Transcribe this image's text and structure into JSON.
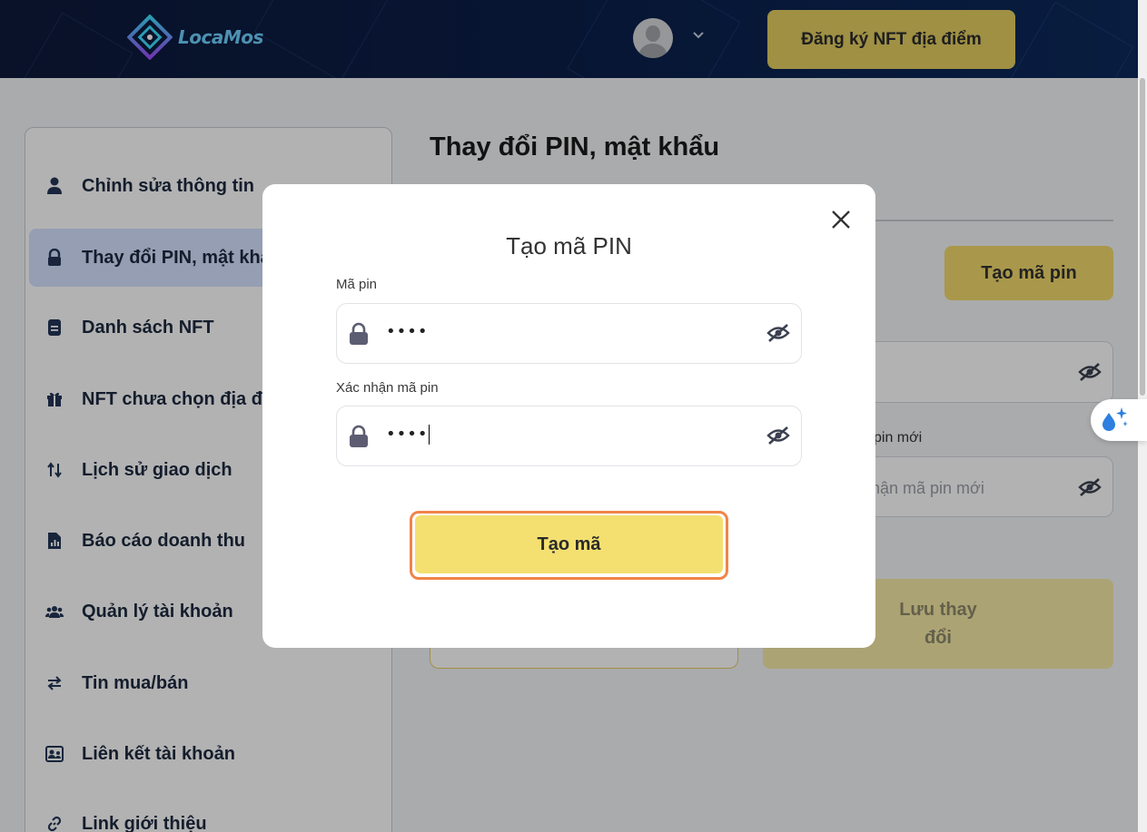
{
  "header": {
    "logo_text": "LocaMos",
    "register_button": "Đăng ký NFT địa điểm"
  },
  "sidebar": {
    "items": [
      {
        "label": "Chỉnh sửa thông tin",
        "icon": "user-icon"
      },
      {
        "label": "Thay đổi PIN, mật khẩu",
        "icon": "lock-icon",
        "active": true
      },
      {
        "label": "Danh sách NFT",
        "icon": "document-icon"
      },
      {
        "label": "NFT chưa chọn địa điểm",
        "icon": "gift-icon"
      },
      {
        "label": "Lịch sử giao dịch",
        "icon": "swap-vertical-icon"
      },
      {
        "label": "Báo cáo doanh thu",
        "icon": "report-icon"
      },
      {
        "label": "Quản lý tài khoản",
        "icon": "users-icon"
      },
      {
        "label": "Tin mua/bán",
        "icon": "swap-horizontal-icon"
      },
      {
        "label": "Liên kết tài khoản",
        "icon": "account-link-icon"
      },
      {
        "label": "Link giới thiệu",
        "icon": "link-icon"
      }
    ]
  },
  "main": {
    "title": "Thay đổi PIN, mật khẩu",
    "create_pin_button": "Tạo mã pin",
    "new_pin_label_partial": "pin mới",
    "confirm_placeholder_partial": "hận mã pin mới",
    "save_button_line1": "Lưu thay",
    "save_button_line2": "đổi"
  },
  "modal": {
    "title": "Tạo mã PIN",
    "pin_label": "Mã pin",
    "pin_value": "••••",
    "confirm_label": "Xác nhận mã pin",
    "confirm_value": "••••",
    "submit_label": "Tạo mã"
  },
  "colors": {
    "accent": "#f4e070",
    "focus_ring": "#f0844a",
    "header_bg": "#0b1f4a"
  }
}
